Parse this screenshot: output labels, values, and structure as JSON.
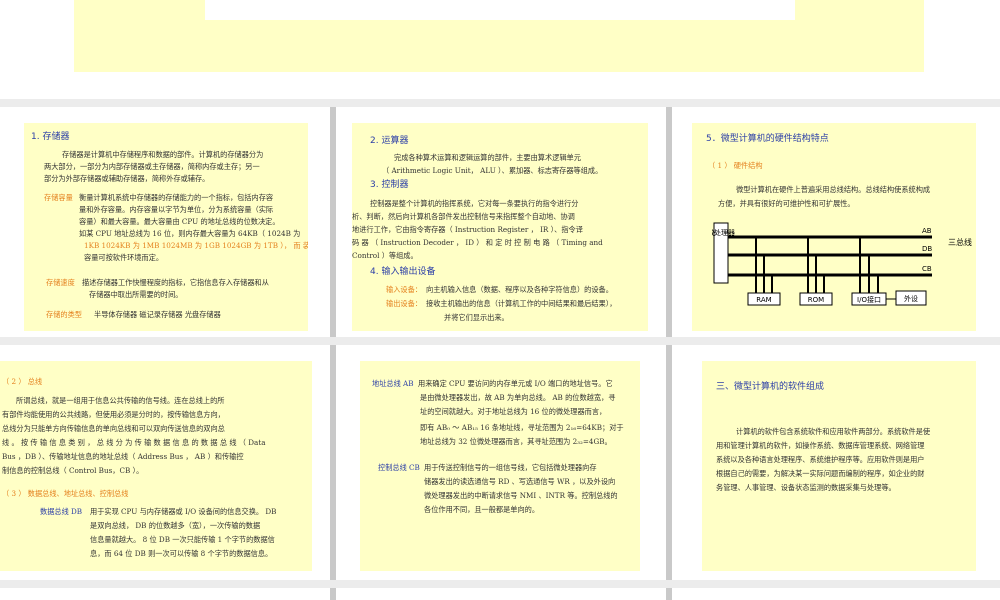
{
  "top_slide": {},
  "s1": {
    "title": "1. 存储器",
    "p1": [
      "存储器是计算机中存储程序和数据的部件。计算机的存储器分为",
      "两大部分，一部分为内部存储器或主存储器，简称内存或主存；另一",
      "部分为外部存储器或辅助存储器，简称外存或辅存。"
    ],
    "cap_label": "存储容量",
    "cap_lines": [
      "衡量计算机系统中存储器的存储能力的一个指标，包括内存容",
      "量和外存容量。内存容量以字节为单位，分为系统容量（实际",
      "容量）和最大容量。最大容量由 CPU 的地址总线的位数决定。",
      "如某 CPU 地址总线为 16 位，则内存最大容量为 64KB（ 1024B 为"
    ],
    "cap_line5": "1KB  1024KB 为 1MB 1024MB 为 1GB 1024GB 为 1TB ）， 而 装机",
    "cap_line6": "容量可按软件环境而定。",
    "speed_label": "存储速度",
    "speed_lines": [
      "描述存储器工作快慢程度的指标，它指信息存入存储器和从",
      "存储器中取出所需要的时间。"
    ],
    "type_label": "存储的类型",
    "types": "半导体存储器      磁记录存储器      光盘存储器"
  },
  "s2": {
    "title2": "2.  运算器",
    "alu": [
      "完成各种算术运算和逻辑运算的部件，主要由算术逻辑单元",
      "（ Arithmetic Logic Unit， ALU ）、累加器、标志寄存器等组成。"
    ],
    "title3": "3.  控制器",
    "ctrl": [
      "控制器是整个计算机的指挥系统，它对每一条要执行的指令进行分",
      "析、判断，然后向计算机各部件发出控制信号来指挥整个自动地、协调",
      "地进行工作，它由指令寄存器（ Instruction Register ， IR ）、指令译",
      "码  器  （  Instruction Decoder  ，  ID  ）  和 定 时 控 制 电 路  （  Timing and",
      "Control ）等组成。"
    ],
    "title4": "4. 输入输出设备",
    "in_label": "输入设备：",
    "in_text": "向主机输入信息（数据、程序以及各种字符信息）的设备。",
    "out_label": "输出设备：",
    "out_text": "接收主机输出的信息（计算机工作的中间结果和最后结果），",
    "out_text2": "并将它们显示出来。"
  },
  "s3": {
    "title": "5．微型计算机的硬件结构特点",
    "sub": "（ 1 ） 硬件结构",
    "p": [
      "微型计算机在硬件上普遍采用总线结构。总线结构使系统构成",
      "方便，并具有很好的可维护性和可扩展性。"
    ],
    "diagram": {
      "cpu": "微处理器",
      "ab": "AB",
      "db": "DB",
      "cb": "CB",
      "bus": "三总线",
      "ram": "RAM",
      "rom": "ROM",
      "io": "I/O接口",
      "dev": "外设"
    }
  },
  "s4": {
    "title": "（ 2 ） 总线",
    "p": [
      "所谓总线，就是一组用于信息公共传输的信号线。连在总线上的所",
      "有部件均能使用的公共线路，但使用必须是分时的，按传输信息方向，",
      "总线分为只能单方向传输信息的单向总线和可以双向传送信息的双向总",
      "线 。 按 传 输 信 息 类 别 ， 总 线 分 为 传 输 数 据 信 息 的 数 据 总 线 （  Data",
      "Bus ，DB ）、传输地址信息的地址总线（ Address Bus  ，  AB  ）和传输控",
      "制信息的控制总线（ Control Bus，CB ）。"
    ],
    "sub": "（ 3 ） 数据总线、地址总线、控制总线",
    "db_label": "数据总线 DB",
    "db_lines": [
      "用于实现 CPU 与内存储器或 I/O 设备间的信息交换。 DB",
      "是双向总线， DB 的位数越多（宽），一次传输的数据",
      "信息量就越大。 8 位 DB 一次只能传输 1 个字节的数据信",
      "息，而 64 位 DB 则一次可以传输 8 个字节的数据信息。"
    ]
  },
  "s5": {
    "ab_label": "地址总线 AB",
    "ab_lines": [
      "用来确定 CPU 要访问的内存单元或 I/O 端口的地址信号。它",
      "是由微处理器发出，故 AB 为单向总线。 AB 的位数越宽，寻",
      "址的空间就越大。对于地址总线为 16 位的微处理器而言，",
      "即有 AB₀ ～ AB₁₅ 16 条地址线，寻址范围为 2₁₆=64KB；对于",
      "地址总线为 32 位微处理器而言，其寻址范围为 2₃₂=4GB。"
    ],
    "cb_label": "控制总线 CB",
    "cb_lines": [
      "用于传送控制信号的一组信号线，它包括微处理器向存",
      "储器发出的读选通信号 RD 、写选通信号 WR ，以及外设向",
      "微处理器发出的中断请求信号 NMI 、INTR 等。控制总线的",
      "各位作用不同，且一般都是单向的。"
    ]
  },
  "s6": {
    "title": "三、微型计算机的软件组成",
    "p": [
      "计算机的软件包含系统软件和应用软件两部分。系统软件是使",
      "用和管理计算机的软件，如操作系统、数据库管理系统、网络管理",
      "系统以及各种语言处理程序、系统维护程序等。应用软件则是用户",
      "根据自己的需要，为解决某一实际问题而编制的程序，如企业的财",
      "务管理、人事管理、设备状态监测的数据采集与处理等。"
    ]
  }
}
